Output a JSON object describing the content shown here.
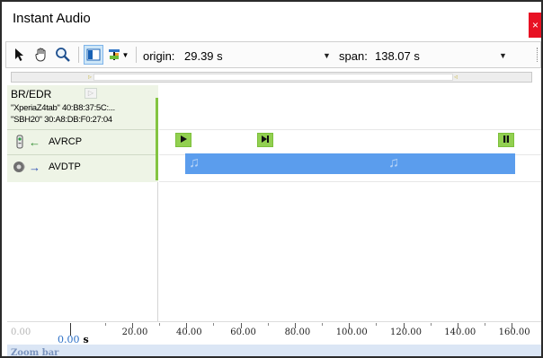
{
  "window": {
    "title": "Instant Audio",
    "close_label": "×"
  },
  "toolbar": {
    "origin_label": "origin:",
    "origin_value": "29.39 s",
    "span_label": "span:",
    "span_value": "138.07 s"
  },
  "left_panel": {
    "section_title": "BR/EDR",
    "devices": [
      "\"XperiaZ4tab\" 40:B8:37:5C:...",
      "\"SBH20\" 30:A8:DB:F0:27:04"
    ],
    "protocols": [
      {
        "name": "AVRCP",
        "direction": "←",
        "icon": "device-remote-icon",
        "arrow_color": "#2e8b2e"
      },
      {
        "name": "AVDTP",
        "direction": "→",
        "icon": "audio-headset-icon",
        "arrow_color": "#2a4db5"
      }
    ]
  },
  "timeline": {
    "events": [
      {
        "name": "play-event",
        "symbol": "▶"
      },
      {
        "name": "next-event",
        "symbol": "▶|"
      },
      {
        "name": "pause-event",
        "symbol": "||"
      }
    ],
    "stream": {
      "name": "audio-stream",
      "color": "#5b9ded"
    }
  },
  "axis": {
    "origin_display": "0.00",
    "origin_unit": "s",
    "faded_start": "0.00",
    "tick_labels": [
      "20.00",
      "40.00",
      "60.00",
      "80.00",
      "100.00",
      "120.00",
      "140.00",
      "160.00"
    ]
  },
  "zoombar": {
    "label": "Zoom bar"
  },
  "colors": {
    "accent_green": "#84c441",
    "event_green": "#92d050",
    "stream_blue": "#5b9ded",
    "zoombar_bg": "#dbe6f5"
  }
}
